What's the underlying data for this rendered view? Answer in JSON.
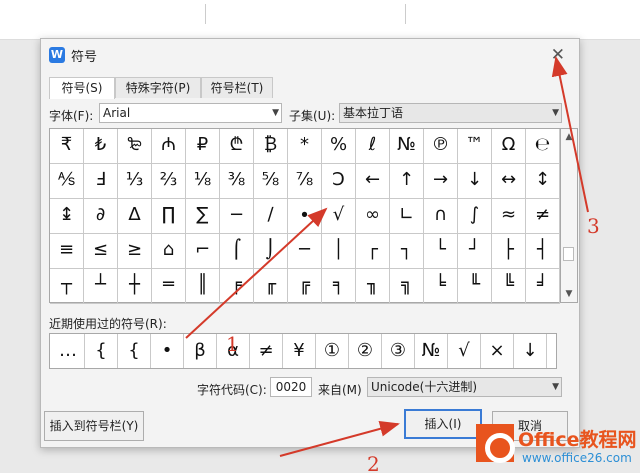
{
  "dialog": {
    "app_icon": "W",
    "title": "符号",
    "close_glyph": "✕",
    "tabs": [
      "符号(S)",
      "特殊字符(P)",
      "符号栏(T)"
    ]
  },
  "font_row": {
    "font_label": "字体(F):",
    "font_value": "Arial",
    "subset_label": "子集(U):",
    "subset_value": "基本拉丁语"
  },
  "symbol_grid": [
    [
      "₹",
      "₺",
      "₻",
      "₼",
      "₽",
      "₾",
      "₿",
      "*",
      "%",
      "ℓ",
      "№",
      "℗",
      "™",
      "Ω",
      "℮"
    ],
    [
      "⅍",
      "Ⅎ",
      "⅓",
      "⅔",
      "⅛",
      "⅜",
      "⅝",
      "⅞",
      "Ↄ",
      "←",
      "↑",
      "→",
      "↓",
      "↔",
      "↕"
    ],
    [
      "↨",
      "∂",
      "∆",
      "∏",
      "∑",
      "−",
      "∕",
      "∙",
      "√",
      "∞",
      "∟",
      "∩",
      "∫",
      "≈",
      "≠"
    ],
    [
      "≡",
      "≤",
      "≥",
      "⌂",
      "⌐",
      "⌠",
      "⌡",
      "─",
      "│",
      "┌",
      "┐",
      "└",
      "┘",
      "├",
      "┤"
    ],
    [
      "┬",
      "┴",
      "┼",
      "═",
      "║",
      "╒",
      "╓",
      "╔",
      "╕",
      "╖",
      "╗",
      "╘",
      "╙",
      "╚",
      "╛"
    ]
  ],
  "recent": {
    "label": "近期使用过的符号(R):",
    "symbols": [
      "…",
      "{",
      "{",
      "•",
      "β",
      "α",
      "≠",
      "¥",
      "①",
      "②",
      "③",
      "№",
      "√",
      "×",
      "↓"
    ]
  },
  "code_row": {
    "code_label": "字符代码(C):",
    "code_value": "0020",
    "from_label": "来自(M)",
    "from_value": "Unicode(十六进制)"
  },
  "buttons": {
    "insert_to_bar": "插入到符号栏(Y)",
    "insert": "插入(I)",
    "cancel": "取消"
  },
  "annotations": [
    "1",
    "2",
    "3"
  ],
  "watermark": {
    "brand": "Office教程网",
    "url": "www.office26.com"
  },
  "colors": {
    "accent": "#3a7bd5",
    "annotation": "#d43a2a",
    "brand_orange": "#e8541e",
    "brand_blue": "#2d8fd5"
  }
}
